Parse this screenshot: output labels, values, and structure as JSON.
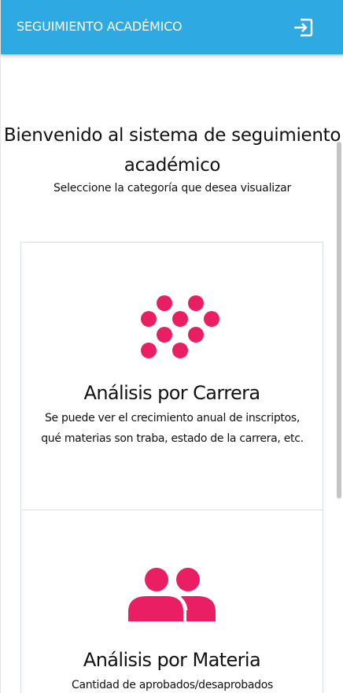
{
  "header": {
    "title": "SEGUIMIENTO ACADÉMICO",
    "logout_icon": "logout-icon"
  },
  "welcome": {
    "title": "Bienvenido al sistema de seguimiento académico",
    "subtitle": "Seleccione la categoría que desea visualizar"
  },
  "cards": [
    {
      "icon": "dots-cluster-icon",
      "title": "Análisis por Carrera",
      "description": "Se puede ver el crecimiento anual de inscriptos, qué materias son traba, estado de la carrera, etc."
    },
    {
      "icon": "users-icon",
      "title": "Análisis por Materia",
      "description": "Cantidad de aprobados/desaprobados"
    }
  ],
  "colors": {
    "header": "#2fa9e1",
    "accent": "#e91e63",
    "card_border": "#d8e2e6"
  }
}
